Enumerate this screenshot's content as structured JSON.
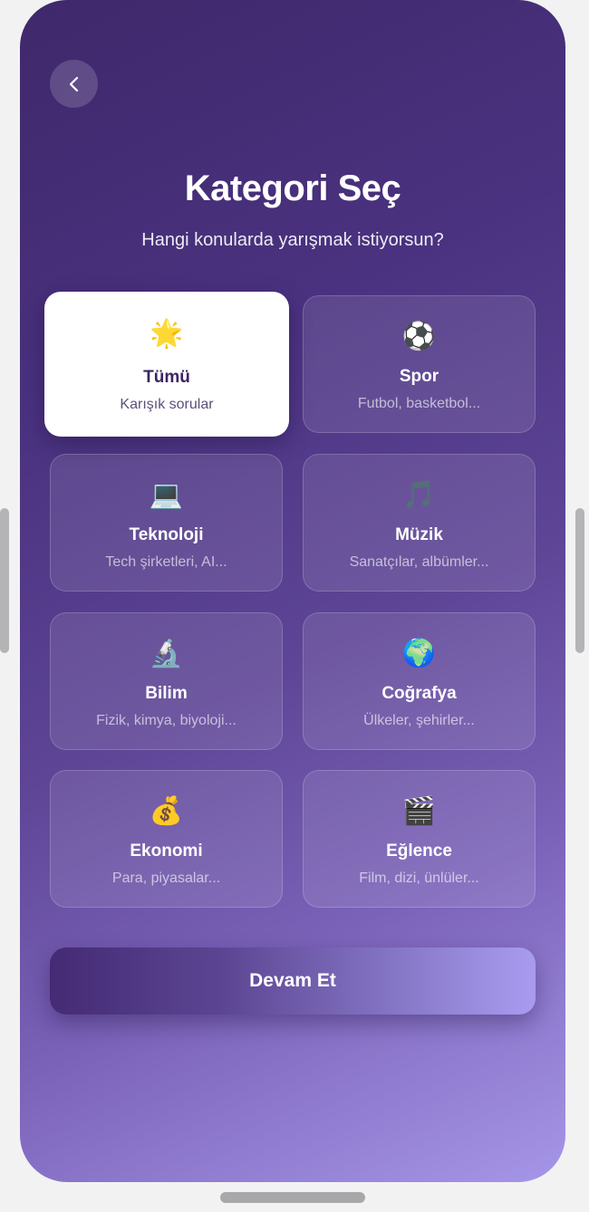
{
  "header": {
    "back_icon": "chevron-left-icon",
    "title": "Kategori Seç",
    "subtitle": "Hangi konularda yarışmak istiyorsun?"
  },
  "categories": [
    {
      "id": "all",
      "emoji": "🌟",
      "name": "Tümü",
      "description": "Karışık sorular",
      "selected": true
    },
    {
      "id": "sports",
      "emoji": "⚽",
      "name": "Spor",
      "description": "Futbol, basketbol...",
      "selected": false
    },
    {
      "id": "technology",
      "emoji": "💻",
      "name": "Teknoloji",
      "description": "Tech şirketleri, AI...",
      "selected": false
    },
    {
      "id": "music",
      "emoji": "🎵",
      "name": "Müzik",
      "description": "Sanatçılar, albümler...",
      "selected": false
    },
    {
      "id": "science",
      "emoji": "🔬",
      "name": "Bilim",
      "description": "Fizik, kimya, biyoloji...",
      "selected": false
    },
    {
      "id": "geography",
      "emoji": "🌍",
      "name": "Coğrafya",
      "description": "Ülkeler, şehirler...",
      "selected": false
    },
    {
      "id": "economy",
      "emoji": "💰",
      "name": "Ekonomi",
      "description": "Para, piyasalar...",
      "selected": false
    },
    {
      "id": "entertainment",
      "emoji": "🎬",
      "name": "Eğlence",
      "description": "Film, dizi, ünlüler...",
      "selected": false
    }
  ],
  "footer": {
    "continue_label": "Devam Et"
  },
  "colors": {
    "background_start": "#40286b",
    "background_end": "#a696e8",
    "selected_card": "#ffffff",
    "selected_text": "#3a2463"
  }
}
